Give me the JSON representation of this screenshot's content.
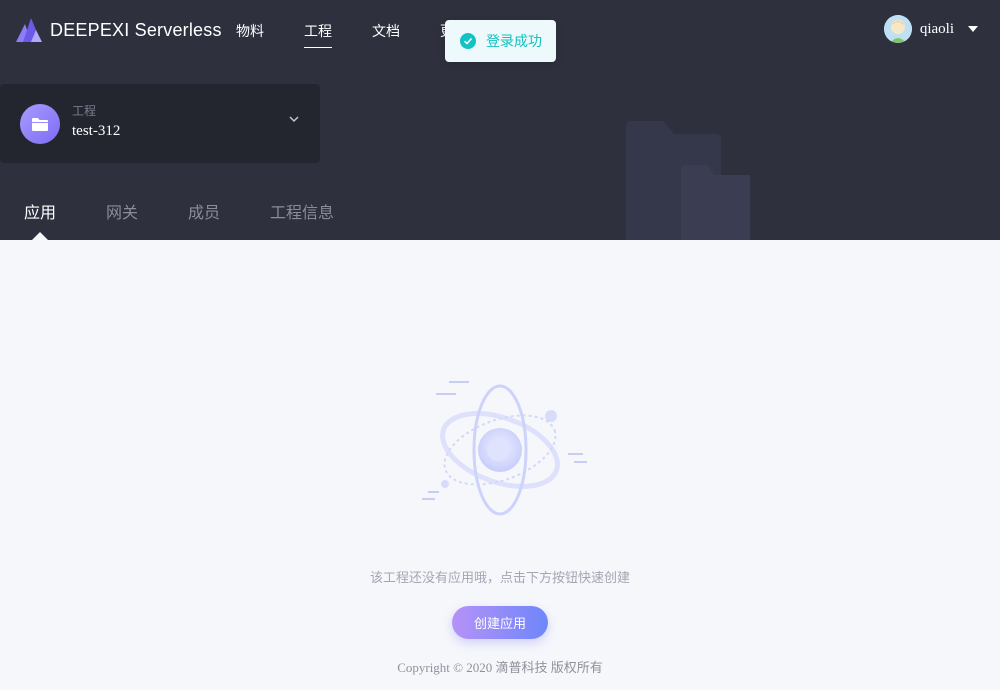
{
  "brand": {
    "name": "DEEPEXI Serverless",
    "logo_icon": "mountain-logo-icon"
  },
  "nav": {
    "items": [
      {
        "label": "物料"
      },
      {
        "label": "工程",
        "active": true
      },
      {
        "label": "文档"
      },
      {
        "label": "更"
      }
    ]
  },
  "user": {
    "name": "qiaoli",
    "avatar_icon": "user-avatar-icon",
    "menu_icon": "caret-down-icon"
  },
  "toast": {
    "message": "登录成功",
    "icon": "check-circle-icon"
  },
  "project": {
    "label": "工程",
    "name": "test-312",
    "icon": "folder-icon",
    "toggle_icon": "chevron-down-icon"
  },
  "tabs": [
    {
      "label": "应用",
      "active": true
    },
    {
      "label": "网关"
    },
    {
      "label": "成员"
    },
    {
      "label": "工程信息"
    }
  ],
  "empty": {
    "illustration_icon": "atom-illustration-icon",
    "message": "该工程还没有应用哦，点击下方按钮快速创建",
    "button_label": "创建应用"
  },
  "footer": {
    "text": "Copyright © 2020 滴普科技 版权所有"
  },
  "colors": {
    "header_bg": "#2e303e",
    "page_bg": "#f6f7fb",
    "success": "#13c2c2",
    "button_gradient_start": "#b592f7",
    "button_gradient_end": "#6f86fb"
  }
}
